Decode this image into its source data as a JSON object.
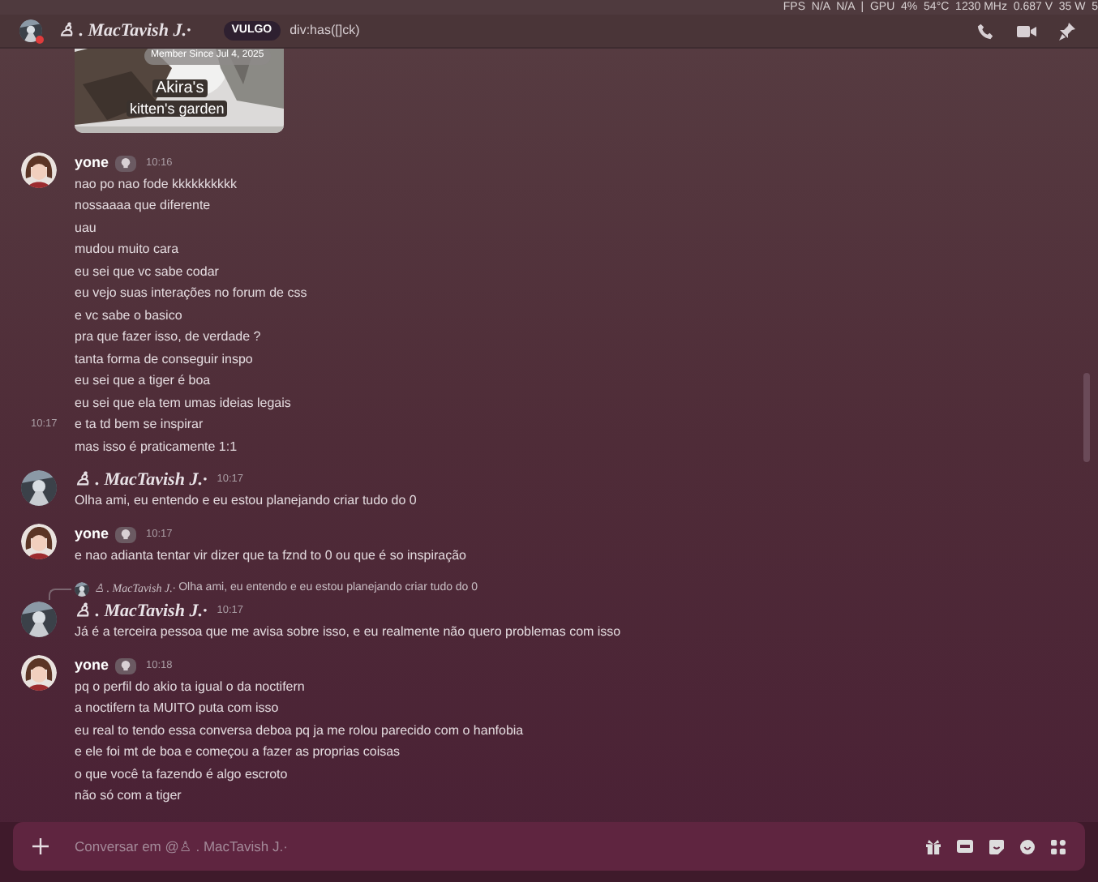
{
  "overlay": {
    "text": "FPS  N/A  N/A  |  GPU  4%  54°C  1230 MHz  0.687 V  35 W  5"
  },
  "header": {
    "name": "♙ . MacTavish J.·",
    "tag": "VULGO",
    "status": "div:has([]ck)",
    "status_online": false
  },
  "card": {
    "member_since": "Member Since Jul 4, 2025",
    "title": "Akira's",
    "subtitle": "kitten's garden"
  },
  "groups": [
    {
      "author": "yone",
      "kind": "plain",
      "tag": true,
      "time": "10:16",
      "lines": [
        {
          "text": "nao po nao fode kkkkkkkkkk"
        },
        {
          "text": "nossaaaa que diferente"
        },
        {
          "text": "uau"
        },
        {
          "text": "mudou muito cara"
        },
        {
          "text": "eu sei que vc sabe codar"
        },
        {
          "text": "eu vejo suas interações no forum de css"
        },
        {
          "text": "e vc sabe o basico"
        },
        {
          "text": "pra que fazer isso, de verdade ?"
        },
        {
          "text": "tanta forma de conseguir inspo"
        },
        {
          "text": "eu sei que a tiger é boa"
        },
        {
          "text": "eu sei que ela tem umas ideias legais"
        },
        {
          "text": "e ta td bem se inspirar",
          "hover_time": "10:17"
        },
        {
          "text": "mas isso é praticamente 1:1"
        }
      ]
    },
    {
      "author": "♙ . MacTavish J.·",
      "kind": "fancy",
      "tag": false,
      "time": "10:17",
      "lines": [
        {
          "text": "Olha ami, eu entendo e eu estou planejando criar tudo do 0"
        }
      ]
    },
    {
      "author": "yone",
      "kind": "plain",
      "tag": true,
      "time": "10:17",
      "lines": [
        {
          "text": "e nao adianta tentar vir dizer que ta fznd to 0 ou que é so inspiração"
        }
      ]
    },
    {
      "author": "♙ . MacTavish J.·",
      "kind": "fancy",
      "tag": false,
      "time": "10:17",
      "reply": {
        "author": "♙ . MacTavish J.·",
        "kind": "fancy",
        "text": "Olha ami, eu entendo e eu estou planejando criar tudo do 0"
      },
      "lines": [
        {
          "text": "Já é a terceira pessoa que me avisa sobre isso, e eu realmente não quero problemas com isso"
        }
      ]
    },
    {
      "author": "yone",
      "kind": "plain",
      "tag": true,
      "time": "10:18",
      "lines": [
        {
          "text": "pq o perfil do akio ta igual o da noctifern"
        },
        {
          "text": "a noctifern ta MUITO puta com isso"
        },
        {
          "text": "eu real to tendo essa conversa deboa pq ja me rolou parecido com o hanfobia"
        },
        {
          "text": "e ele foi mt de boa e começou a fazer as proprias coisas"
        },
        {
          "text": "o que você ta fazendo é algo escroto"
        },
        {
          "text": "não só com a tiger"
        }
      ]
    }
  ],
  "composer": {
    "placeholder": "Conversar em @♙ . MacTavish J.·"
  }
}
